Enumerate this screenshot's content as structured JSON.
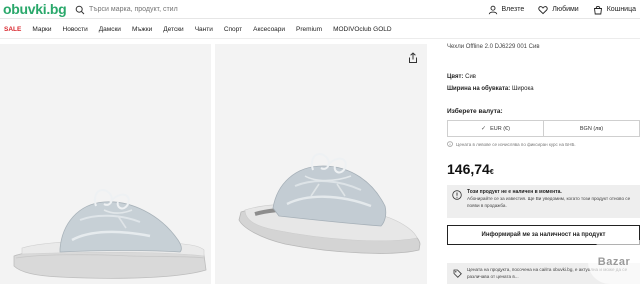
{
  "header": {
    "logo": "obuvki.bg",
    "search_placeholder": "Търси марка, продукт, стил",
    "actions": [
      {
        "label": "Влезте",
        "icon": "user-icon"
      },
      {
        "label": "Любими",
        "icon": "heart-icon"
      },
      {
        "label": "Кошница",
        "icon": "cart-icon"
      }
    ]
  },
  "nav": {
    "items": [
      "SALE",
      "Марки",
      "Новости",
      "Дамски",
      "Мъжки",
      "Детски",
      "Чанти",
      "Спорт",
      "Аксесоари",
      "Premium",
      "MODIVOclub GOLD"
    ]
  },
  "product": {
    "title": "Чехли Offline 2.0 DJ6229 001 Сив",
    "color_label": "Цвят:",
    "color_value": "Сив",
    "width_label": "Ширина на обувката:",
    "width_value": "Широка",
    "currency_label": "Изберете валута:",
    "currency_options": [
      "EUR (€)",
      "BGN (лв)"
    ],
    "currency_selected": "EUR (€)",
    "currency_note": "Цената в левове се изчислява по фиксиран курс на БНБ.",
    "price": "146,74",
    "price_currency": "€",
    "oos_title": "Този продукт не е наличен в момента.",
    "oos_text": "Абонирайте се за известия. Ще Ви уведомим, когато този продукт отново се появи в продажба.",
    "notify_button": "Информирай ме за наличност на продукт",
    "bottom_note": "Цената на продукта, посочена на сайта obuvki.bg, е актуална и може да се различава от цената в..."
  },
  "watermark": "Bazar",
  "colors": {
    "brand": "#2aa86b",
    "sale": "#d9272e",
    "box_bg": "#eeeeee"
  }
}
